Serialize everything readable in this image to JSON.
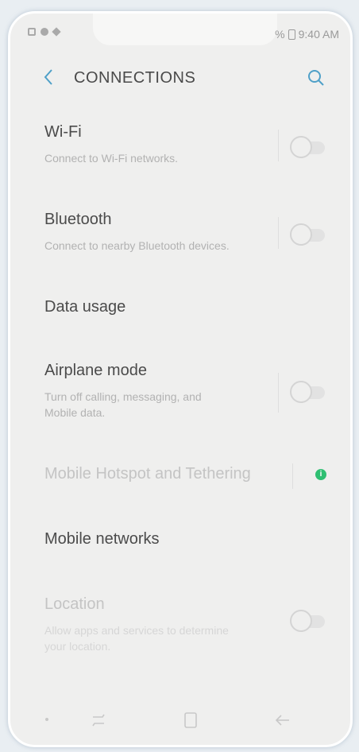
{
  "status": {
    "time": "9:40 AM",
    "signal": "%"
  },
  "header": {
    "title": "CONNECTIONS"
  },
  "items": [
    {
      "title": "Wi-Fi",
      "subtitle": "Connect to Wi-Fi networks."
    },
    {
      "title": "Bluetooth",
      "subtitle": "Connect to nearby Bluetooth devices."
    },
    {
      "title": "Data usage"
    },
    {
      "title": "Airplane mode",
      "subtitle_line1": "Turn off calling, messaging, and",
      "subtitle_line2": "Mobile data."
    },
    {
      "title": "Mobile Hotspot and Tethering"
    },
    {
      "title": "Mobile networks"
    },
    {
      "title": "Location",
      "subtitle_line1": "Allow apps and services to determine",
      "subtitle_line2": "your location."
    }
  ],
  "colors": {
    "accent": "#4fa0c8",
    "info": "#2fbf72"
  },
  "icons": {
    "back": "chevron-left-icon",
    "search": "search-icon",
    "info": "info-icon",
    "recents": "recents-icon",
    "home": "home-icon",
    "nav_back": "back-arrow-icon"
  }
}
